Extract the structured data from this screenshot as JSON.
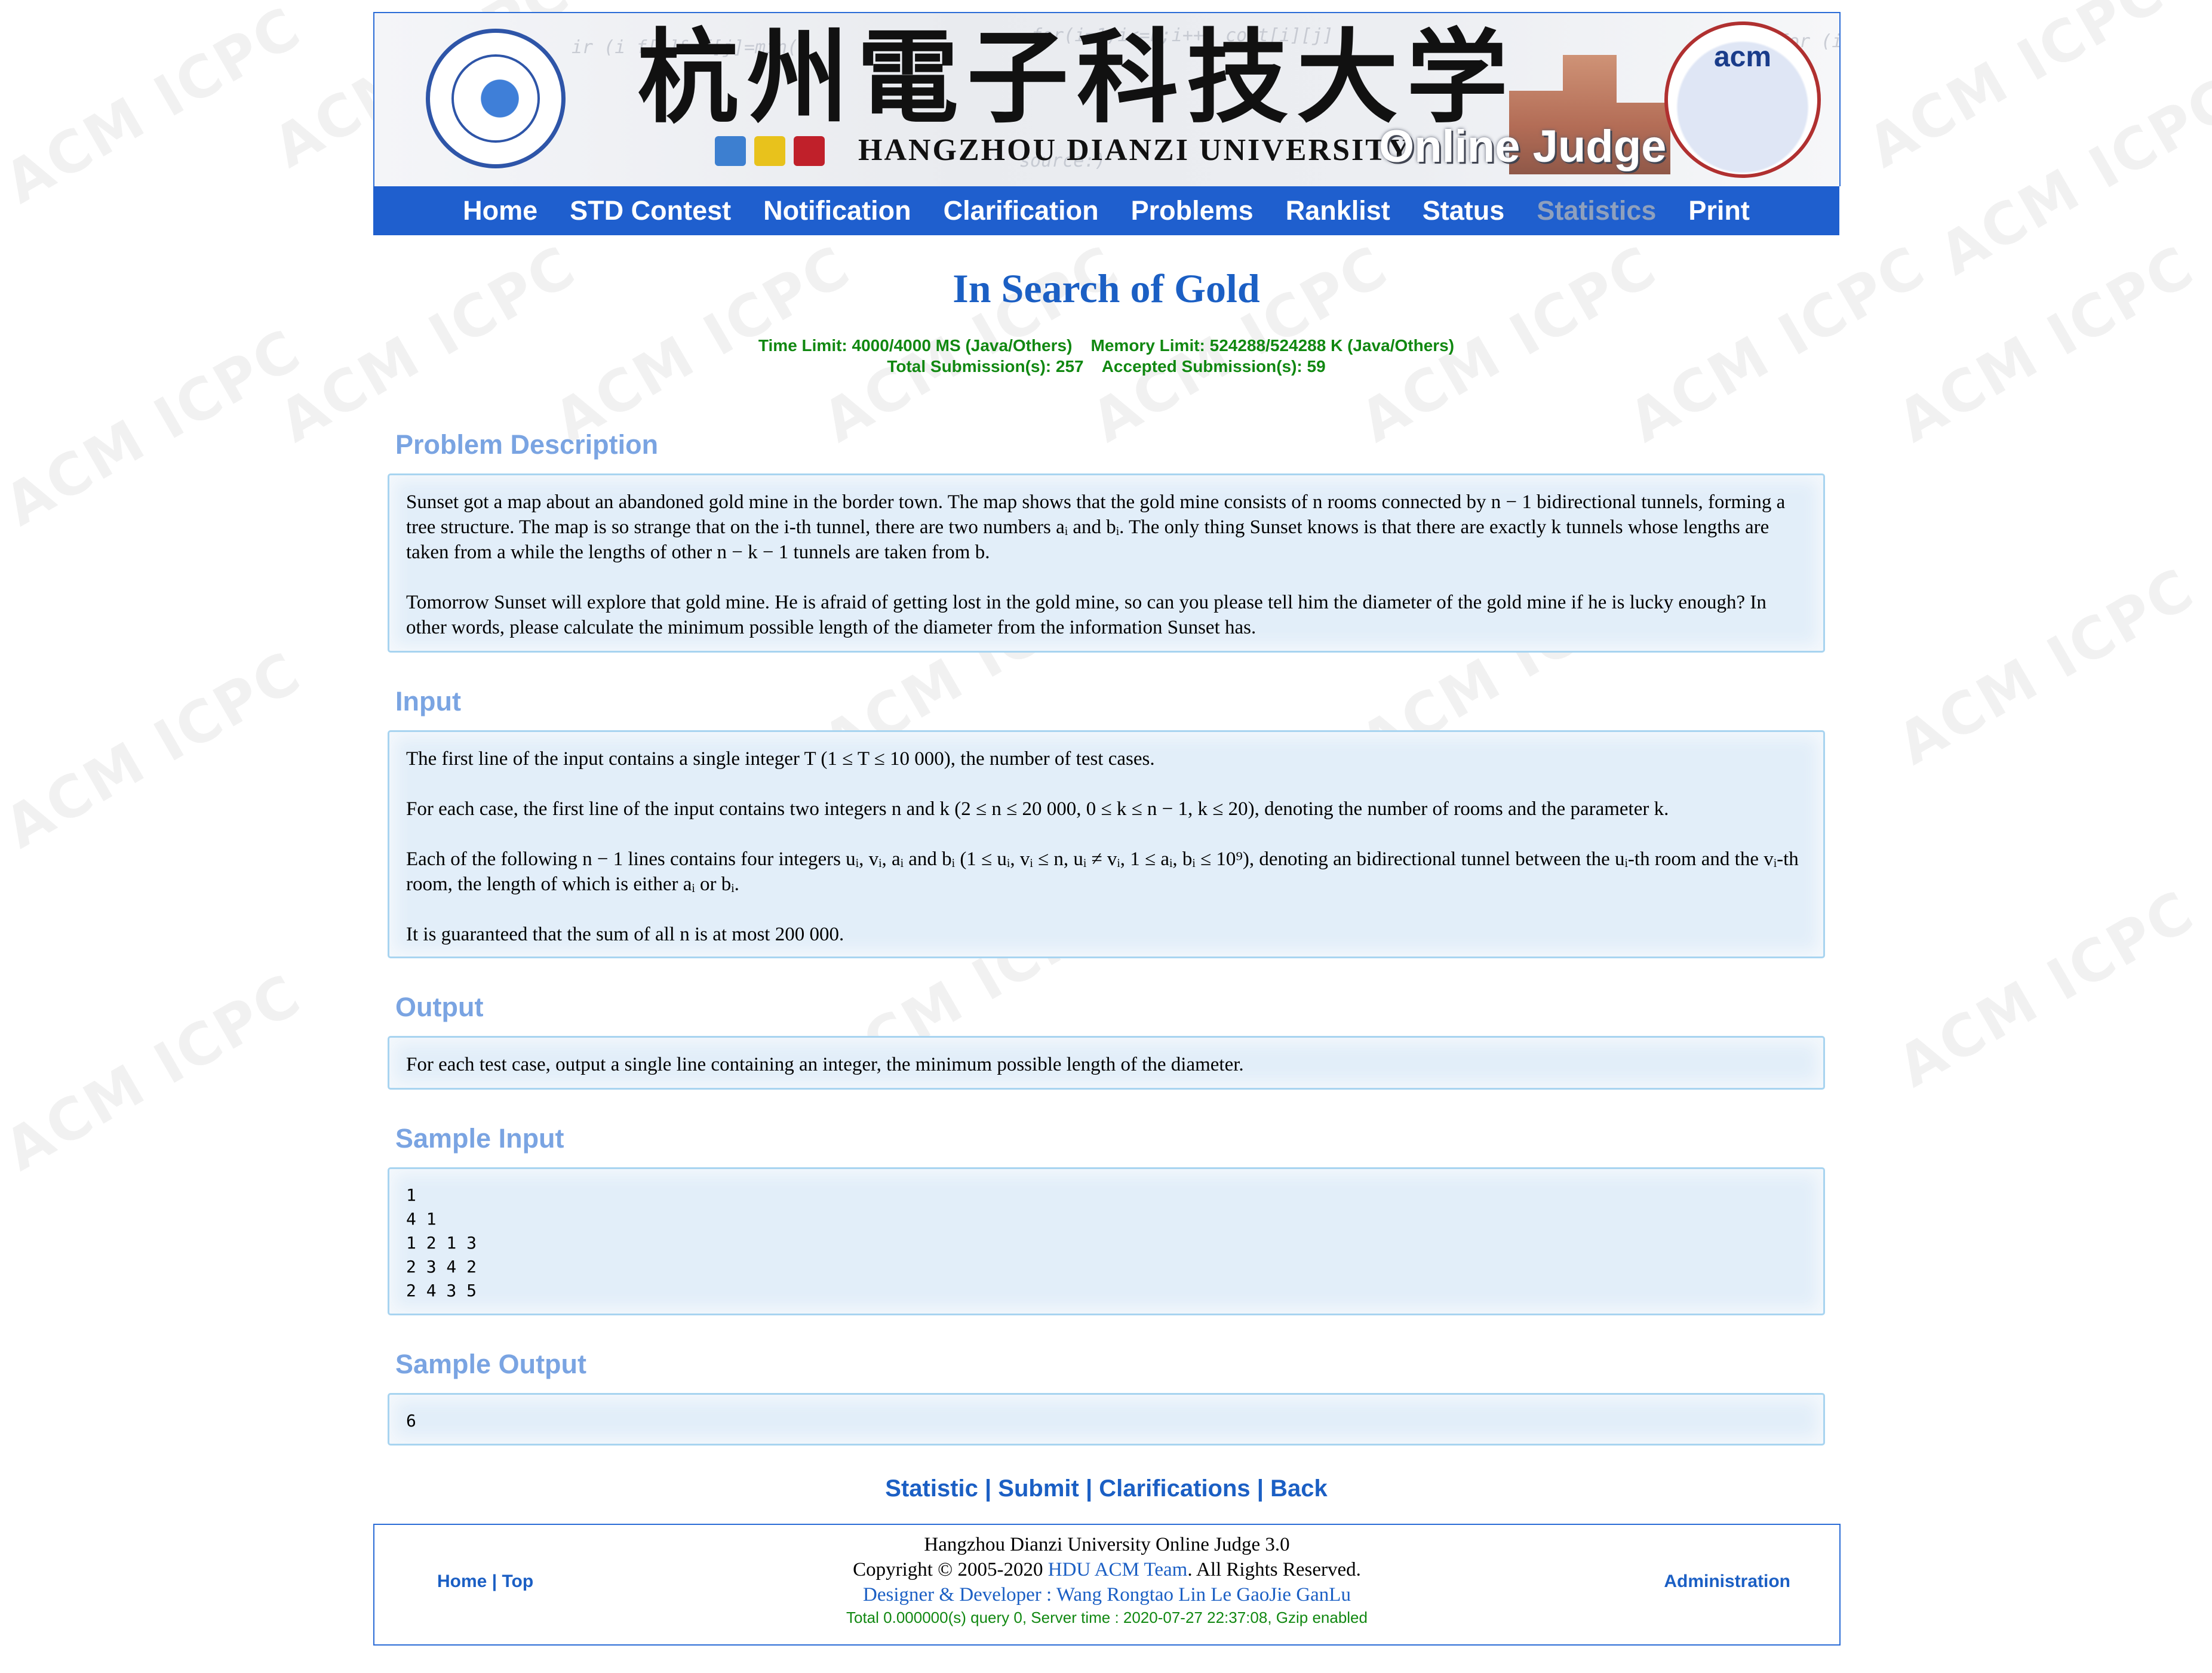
{
  "header": {
    "cn_title": "杭州電子科技大学",
    "en_title": "HANGZHOU DIANZI UNIVERSITY",
    "oj_title": "Online Judge",
    "acm_logo_text": "acm"
  },
  "nav": {
    "items": [
      "Home",
      "STD Contest",
      "Notification",
      "Clarification",
      "Problems",
      "Ranklist",
      "Status",
      "Statistics",
      "Print"
    ]
  },
  "problem": {
    "title": "In Search of Gold",
    "limits_line1": "Time Limit: 4000/4000 MS (Java/Others)    Memory Limit: 524288/524288 K (Java/Others)",
    "limits_line2": "Total Submission(s): 257    Accepted Submission(s): 59"
  },
  "sections": {
    "description_head": "Problem Description",
    "description_p1": "Sunset got a map about an abandoned gold mine in the border town. The map shows that the gold mine consists of n rooms connected by n − 1 bidirectional tunnels, forming a tree structure. The map is so strange that on the i-th tunnel, there are two numbers aᵢ and bᵢ. The only thing Sunset knows is that there are exactly k tunnels whose lengths are taken from a while the lengths of other n − k − 1 tunnels are taken from b.",
    "description_p2": "Tomorrow Sunset will explore that gold mine. He is afraid of getting lost in the gold mine, so can you please tell him the diameter of the gold mine if he is lucky enough? In other words, please calculate the minimum possible length of the diameter from the information Sunset has.",
    "input_head": "Input",
    "input_p1": "The first line of the input contains a single integer T (1 ≤ T ≤ 10 000), the number of test cases.",
    "input_p2": "For each case, the first line of the input contains two integers n and k (2 ≤ n ≤ 20 000, 0 ≤ k ≤ n − 1, k ≤ 20), denoting the number of rooms and the parameter k.",
    "input_p3": "Each of the following n − 1 lines contains four integers uᵢ, vᵢ, aᵢ and bᵢ (1 ≤ uᵢ, vᵢ ≤ n, uᵢ ≠ vᵢ, 1 ≤ aᵢ, bᵢ ≤ 10⁹), denoting an bidirectional tunnel between the uᵢ-th room and the vᵢ-th room, the length of which is either aᵢ or bᵢ.",
    "input_p4": "It is guaranteed that the sum of all n is at most 200 000.",
    "output_head": "Output",
    "output_p1": "For each test case, output a single line containing an integer, the minimum possible length of the diameter.",
    "sample_input_head": "Sample Input",
    "sample_input": "1\n4 1\n1 2 1 3\n2 3 4 2\n2 4 3 5",
    "sample_output_head": "Sample Output",
    "sample_output": "6"
  },
  "bottom_links": {
    "statistic": "Statistic",
    "submit": "Submit",
    "clarifications": "Clarifications",
    "back": "Back",
    "sep": " | "
  },
  "footer": {
    "home": "Home",
    "top": "Top",
    "sep": " | ",
    "line1": "Hangzhou Dianzi University Online Judge 3.0",
    "copyright_pre": "Copyright © 2005-2020 ",
    "team": "HDU ACM Team",
    "copyright_post": ". All Rights Reserved.",
    "designers": "Designer & Developer : Wang Rongtao Lin Le GaoJie GanLu",
    "server": "Total 0.000000(s) query 0, Server time : 2020-07-27 22:37:08, Gzip enabled",
    "admin": "Administration"
  },
  "watermark": "ACM ICPC",
  "colors": {
    "nav_bg": "#1f5fce",
    "title": "#1b5fc4",
    "section_head": "#7aa4e2",
    "limits": "#118811",
    "panel_bg": "#e2eef9",
    "panel_border": "#a8d4f0"
  }
}
